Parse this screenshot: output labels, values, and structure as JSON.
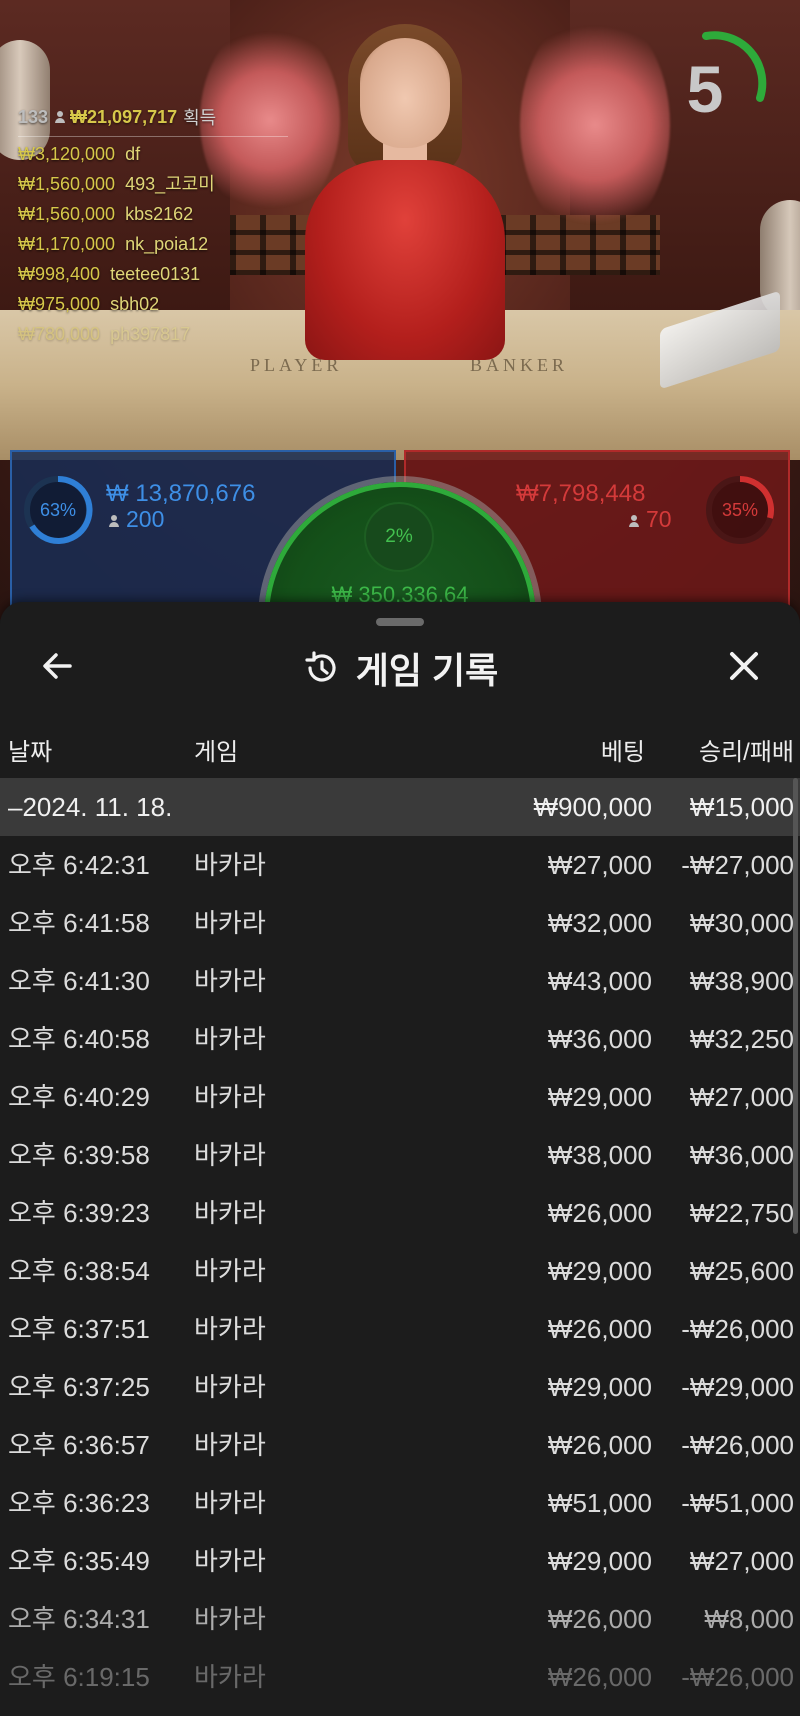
{
  "video": {
    "timer": "5",
    "table_player_label": "PLAYER",
    "table_banker_label": "BANKER"
  },
  "winners": {
    "count": "133",
    "total": "₩21,097,717",
    "suffix": "획득",
    "list": [
      {
        "amount": "₩3,120,000",
        "name": "df"
      },
      {
        "amount": "₩1,560,000",
        "name": "493_고코미"
      },
      {
        "amount": "₩1,560,000",
        "name": "kbs2162"
      },
      {
        "amount": "₩1,170,000",
        "name": "nk_poia12"
      },
      {
        "amount": "₩998,400",
        "name": "teetee0131"
      },
      {
        "amount": "₩975,000",
        "name": "sbh02"
      },
      {
        "amount": "₩780,000",
        "name": "ph397817"
      }
    ]
  },
  "bets": {
    "player": {
      "pct": "63%",
      "amount": "₩ 13,870,676",
      "players": "200",
      "color": "#2f7fd6"
    },
    "banker": {
      "pct": "35%",
      "amount": "₩7,798,448",
      "players": "70",
      "color": "#d03030"
    },
    "tie": {
      "pct": "2%",
      "amount": "₩ 350,336.64",
      "color": "#3cb848"
    }
  },
  "sheet": {
    "title": "게임 기록",
    "columns": {
      "date": "날짜",
      "game": "게임",
      "bet": "베팅",
      "result": "승리/패배"
    },
    "date_group": {
      "date": "–2024. 11. 18.",
      "bet": "₩900,000",
      "result": "₩15,000"
    },
    "rows": [
      {
        "time": "오후 6:42:31",
        "game": "바카라",
        "bet": "₩27,000",
        "result": "-₩27,000"
      },
      {
        "time": "오후 6:41:58",
        "game": "바카라",
        "bet": "₩32,000",
        "result": "₩30,000"
      },
      {
        "time": "오후 6:41:30",
        "game": "바카라",
        "bet": "₩43,000",
        "result": "₩38,900"
      },
      {
        "time": "오후 6:40:58",
        "game": "바카라",
        "bet": "₩36,000",
        "result": "₩32,250"
      },
      {
        "time": "오후 6:40:29",
        "game": "바카라",
        "bet": "₩29,000",
        "result": "₩27,000"
      },
      {
        "time": "오후 6:39:58",
        "game": "바카라",
        "bet": "₩38,000",
        "result": "₩36,000"
      },
      {
        "time": "오후 6:39:23",
        "game": "바카라",
        "bet": "₩26,000",
        "result": "₩22,750"
      },
      {
        "time": "오후 6:38:54",
        "game": "바카라",
        "bet": "₩29,000",
        "result": "₩25,600"
      },
      {
        "time": "오후 6:37:51",
        "game": "바카라",
        "bet": "₩26,000",
        "result": "-₩26,000"
      },
      {
        "time": "오후 6:37:25",
        "game": "바카라",
        "bet": "₩29,000",
        "result": "-₩29,000"
      },
      {
        "time": "오후 6:36:57",
        "game": "바카라",
        "bet": "₩26,000",
        "result": "-₩26,000"
      },
      {
        "time": "오후 6:36:23",
        "game": "바카라",
        "bet": "₩51,000",
        "result": "-₩51,000"
      },
      {
        "time": "오후 6:35:49",
        "game": "바카라",
        "bet": "₩29,000",
        "result": "₩27,000"
      },
      {
        "time": "오후 6:34:31",
        "game": "바카라",
        "bet": "₩26,000",
        "result": "₩8,000"
      },
      {
        "time": "오후 6:19:15",
        "game": "바카라",
        "bet": "₩26,000",
        "result": "-₩26,000"
      }
    ]
  },
  "icons": {
    "back": "arrow-left-icon",
    "history": "history-icon",
    "close": "close-icon",
    "player": "person-icon"
  }
}
